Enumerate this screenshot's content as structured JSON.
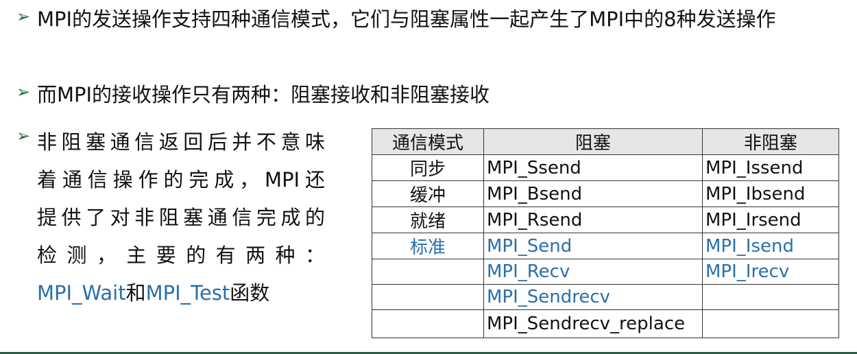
{
  "bullets": {
    "b1": "MPI的发送操作支持四种通信模式，它们与阻塞属性一起产生了MPI中的8种发送操作",
    "b2": "而MPI的接收操作只有两种：阻塞接收和非阻塞接收",
    "b3": {
      "line1": "非阻塞通信返回后并不意味",
      "line2": "着通信操作的完成，MPI还",
      "line3": "提供了对非阻塞通信完成的",
      "line4": "检测，主要的有两种：",
      "func1": "MPI_Wait",
      "and": "和",
      "func2": "MPI_Test",
      "tail": "函数"
    }
  },
  "table": {
    "headers": [
      "通信模式",
      "阻塞",
      "非阻塞"
    ],
    "rows": [
      {
        "mode": "同步",
        "blocking": "MPI_Ssend",
        "nonblocking": "MPI_Issend"
      },
      {
        "mode": "缓冲",
        "blocking": "MPI_Bsend",
        "nonblocking": "MPI_Ibsend"
      },
      {
        "mode": "就绪",
        "blocking": "MPI_Rsend",
        "nonblocking": "MPI_Irsend"
      },
      {
        "mode": "标准",
        "blocking": "MPI_Send",
        "nonblocking": "MPI_Isend"
      },
      {
        "mode": "",
        "blocking": "MPI_Recv",
        "nonblocking": "MPI_Irecv"
      },
      {
        "mode": "",
        "blocking": "MPI_Sendrecv",
        "nonblocking": ""
      },
      {
        "mode": "",
        "blocking": "MPI_Sendrecv_replace",
        "nonblocking": ""
      }
    ]
  },
  "colors": {
    "arrow": "#1f6a3a",
    "highlight": "#2a6fa8",
    "header_bg": "#e6e6e6",
    "bottom_rule": "#2c5e46"
  }
}
